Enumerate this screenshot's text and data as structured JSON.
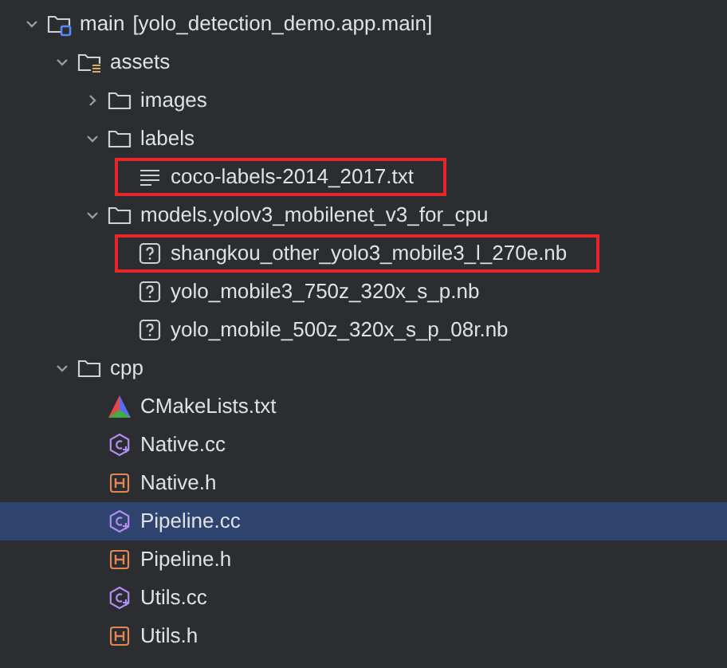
{
  "tree": [
    {
      "kind": "source-folder",
      "label": "main",
      "suffix": "[yolo_detection_demo.app.main]",
      "expanded": true,
      "selected": false,
      "marked": false,
      "children": [
        {
          "kind": "resource-folder",
          "label": "assets",
          "expanded": true,
          "selected": false,
          "marked": false,
          "children": [
            {
              "kind": "folder",
              "label": "images",
              "expanded": false,
              "selected": false,
              "marked": false
            },
            {
              "kind": "folder",
              "label": "labels",
              "expanded": true,
              "selected": false,
              "marked": false,
              "children": [
                {
                  "kind": "text-file",
                  "label": "coco-labels-2014_2017.txt",
                  "selected": false,
                  "marked": true
                }
              ]
            },
            {
              "kind": "folder",
              "label": "models.yolov3_mobilenet_v3_for_cpu",
              "expanded": true,
              "selected": false,
              "marked": false,
              "children": [
                {
                  "kind": "unknown-file",
                  "label": "shangkou_other_yolo3_mobile3_l_270e.nb",
                  "selected": false,
                  "marked": true
                },
                {
                  "kind": "unknown-file",
                  "label": "yolo_mobile3_750z_320x_s_p.nb",
                  "selected": false,
                  "marked": false
                },
                {
                  "kind": "unknown-file",
                  "label": "yolo_mobile_500z_320x_s_p_08r.nb",
                  "selected": false,
                  "marked": false
                }
              ]
            }
          ]
        },
        {
          "kind": "folder",
          "label": "cpp",
          "expanded": true,
          "selected": false,
          "marked": false,
          "children": [
            {
              "kind": "cmake",
              "label": "CMakeLists.txt",
              "selected": false,
              "marked": false
            },
            {
              "kind": "cpp",
              "label": "Native.cc",
              "selected": false,
              "marked": false
            },
            {
              "kind": "header",
              "label": "Native.h",
              "selected": false,
              "marked": false
            },
            {
              "kind": "cpp",
              "label": "Pipeline.cc",
              "selected": true,
              "marked": false
            },
            {
              "kind": "header",
              "label": "Pipeline.h",
              "selected": false,
              "marked": false
            },
            {
              "kind": "cpp",
              "label": "Utils.cc",
              "selected": false,
              "marked": false
            },
            {
              "kind": "header",
              "label": "Utils.h",
              "selected": false,
              "marked": false
            }
          ]
        }
      ]
    }
  ]
}
